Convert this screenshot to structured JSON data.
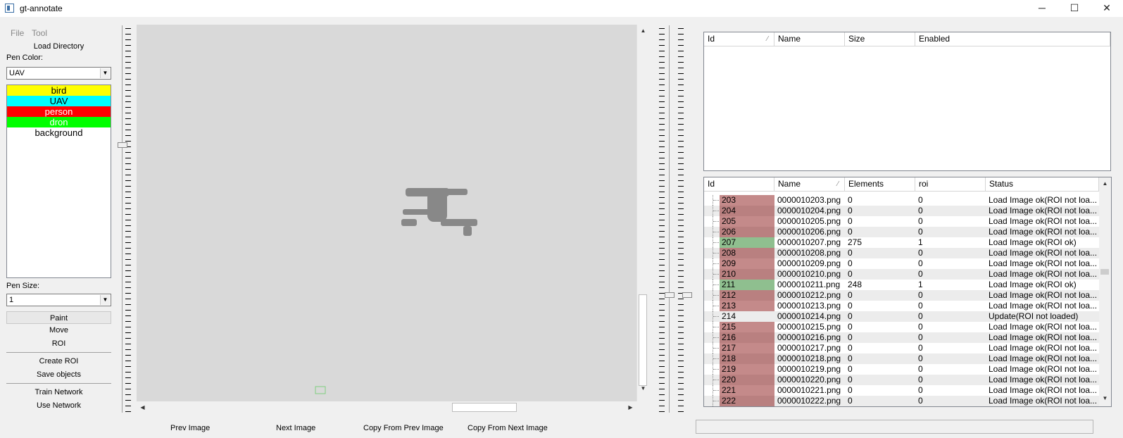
{
  "window": {
    "title": "gt-annotate",
    "minimize": "─",
    "maximize": "☐",
    "close": "✕"
  },
  "menu": {
    "file": "File",
    "tool": "Tool"
  },
  "left": {
    "load_directory": "Load Directory",
    "pen_color_label": "Pen Color:",
    "pen_color_value": "UAV",
    "colors": [
      {
        "name": "bird",
        "bg": "#ffff00",
        "fg": "#000000"
      },
      {
        "name": "UAV",
        "bg": "#00ffff",
        "fg": "#000000"
      },
      {
        "name": "person",
        "bg": "#ff0000",
        "fg": "#ffffff"
      },
      {
        "name": "dron",
        "bg": "#00ff00",
        "fg": "#ffffff"
      },
      {
        "name": "background",
        "bg": "#ffffff",
        "fg": "#000000"
      }
    ],
    "pen_size_label": "Pen Size:",
    "pen_size_value": "1",
    "paint": "Paint",
    "move": "Move",
    "roi": "ROI",
    "create_roi": "Create ROI",
    "save_objects": "Save objects",
    "train_network": "Train Network",
    "use_network": "Use Network"
  },
  "bottom": {
    "prev_image": "Prev Image",
    "next_image": "Next Image",
    "copy_prev": "Copy From Prev Image",
    "copy_next": "Copy From Next Image"
  },
  "objects_table": {
    "headers": [
      "Id",
      "Name",
      "Size",
      "Enabled"
    ]
  },
  "images_table": {
    "headers": [
      "Id",
      "Name",
      "Elements",
      "roi",
      "Status"
    ],
    "rows": [
      {
        "id": "203",
        "name": "0000010203.png",
        "elements": "0",
        "roi": "0",
        "status": "Load Image ok(ROI not loa...",
        "state": "red"
      },
      {
        "id": "204",
        "name": "0000010204.png",
        "elements": "0",
        "roi": "0",
        "status": "Load Image ok(ROI not loa...",
        "state": "red"
      },
      {
        "id": "205",
        "name": "0000010205.png",
        "elements": "0",
        "roi": "0",
        "status": "Load Image ok(ROI not loa...",
        "state": "red"
      },
      {
        "id": "206",
        "name": "0000010206.png",
        "elements": "0",
        "roi": "0",
        "status": "Load Image ok(ROI not loa...",
        "state": "red"
      },
      {
        "id": "207",
        "name": "0000010207.png",
        "elements": "275",
        "roi": "1",
        "status": "Load Image ok(ROI ok)",
        "state": "green"
      },
      {
        "id": "208",
        "name": "0000010208.png",
        "elements": "0",
        "roi": "0",
        "status": "Load Image ok(ROI not loa...",
        "state": "red"
      },
      {
        "id": "209",
        "name": "0000010209.png",
        "elements": "0",
        "roi": "0",
        "status": "Load Image ok(ROI not loa...",
        "state": "red"
      },
      {
        "id": "210",
        "name": "0000010210.png",
        "elements": "0",
        "roi": "0",
        "status": "Load Image ok(ROI not loa...",
        "state": "red"
      },
      {
        "id": "211",
        "name": "0000010211.png",
        "elements": "248",
        "roi": "1",
        "status": "Load Image ok(ROI ok)",
        "state": "green"
      },
      {
        "id": "212",
        "name": "0000010212.png",
        "elements": "0",
        "roi": "0",
        "status": "Load Image ok(ROI not loa...",
        "state": "red"
      },
      {
        "id": "213",
        "name": "0000010213.png",
        "elements": "0",
        "roi": "0",
        "status": "Load Image ok(ROI not loa...",
        "state": "red"
      },
      {
        "id": "214",
        "name": "0000010214.png",
        "elements": "0",
        "roi": "0",
        "status": "Update(ROI not loaded)",
        "state": "none"
      },
      {
        "id": "215",
        "name": "0000010215.png",
        "elements": "0",
        "roi": "0",
        "status": "Load Image ok(ROI not loa...",
        "state": "red"
      },
      {
        "id": "216",
        "name": "0000010216.png",
        "elements": "0",
        "roi": "0",
        "status": "Load Image ok(ROI not loa...",
        "state": "red"
      },
      {
        "id": "217",
        "name": "0000010217.png",
        "elements": "0",
        "roi": "0",
        "status": "Load Image ok(ROI not loa...",
        "state": "red"
      },
      {
        "id": "218",
        "name": "0000010218.png",
        "elements": "0",
        "roi": "0",
        "status": "Load Image ok(ROI not loa...",
        "state": "red"
      },
      {
        "id": "219",
        "name": "0000010219.png",
        "elements": "0",
        "roi": "0",
        "status": "Load Image ok(ROI not loa...",
        "state": "red"
      },
      {
        "id": "220",
        "name": "0000010220.png",
        "elements": "0",
        "roi": "0",
        "status": "Load Image ok(ROI not loa...",
        "state": "red"
      },
      {
        "id": "221",
        "name": "0000010221.png",
        "elements": "0",
        "roi": "0",
        "status": "Load Image ok(ROI not loa...",
        "state": "red"
      },
      {
        "id": "222",
        "name": "0000010222.png",
        "elements": "0",
        "roi": "0",
        "status": "Load Image ok(ROI not loa...",
        "state": "red"
      }
    ]
  },
  "state_colors": {
    "red": "#c48a8a",
    "red_alt": "#b98080",
    "green": "#8fbf8f"
  }
}
